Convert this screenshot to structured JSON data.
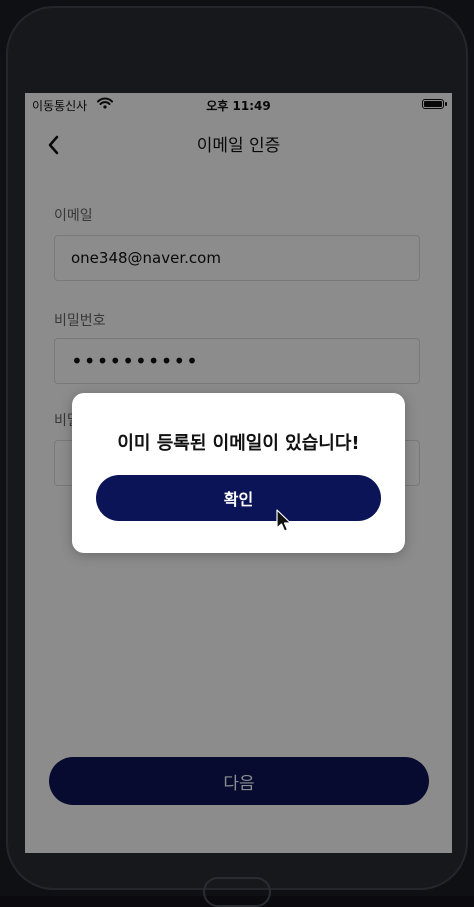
{
  "status_bar": {
    "carrier": "이동통신사",
    "time": "오후 11:49"
  },
  "header": {
    "title": "이메일 인증"
  },
  "form": {
    "email_label": "이메일",
    "email_value": "one348@naver.com",
    "password_label": "비밀번호",
    "password_value": "••••••••••",
    "confirm_label_partial": "비밀",
    "confirm_value_partial": "•"
  },
  "footer": {
    "next_label": "다음"
  },
  "modal": {
    "message": "이미 등록된 이메일이 있습니다!",
    "confirm_label": "확인"
  },
  "colors": {
    "primary": "#0b1457",
    "overlay": "rgba(0,0,0,0.45)"
  },
  "icons": {
    "back": "chevron-left-icon",
    "wifi": "wifi-icon",
    "battery": "battery-icon",
    "cursor": "cursor-icon"
  }
}
